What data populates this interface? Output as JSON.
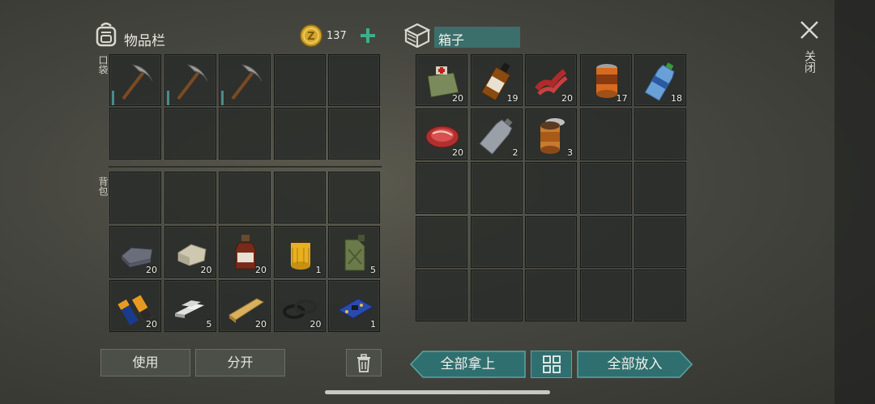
{
  "inventory": {
    "title": "物品栏",
    "coins": "137",
    "pocket_label": "口袋",
    "backpack_label": "背包",
    "pocket_slots": [
      {
        "item": "pickaxe",
        "qty": ""
      },
      {
        "item": "pickaxe",
        "qty": ""
      },
      {
        "item": "pickaxe",
        "qty": ""
      },
      {
        "item": "",
        "qty": ""
      },
      {
        "item": "",
        "qty": ""
      },
      {
        "item": "",
        "qty": ""
      },
      {
        "item": "",
        "qty": ""
      },
      {
        "item": "",
        "qty": ""
      },
      {
        "item": "",
        "qty": ""
      },
      {
        "item": "",
        "qty": ""
      }
    ],
    "backpack_slots": [
      {
        "item": "",
        "qty": ""
      },
      {
        "item": "",
        "qty": ""
      },
      {
        "item": "",
        "qty": ""
      },
      {
        "item": "",
        "qty": ""
      },
      {
        "item": "",
        "qty": ""
      },
      {
        "item": "iron-ingot",
        "qty": "20"
      },
      {
        "item": "stone-block",
        "qty": "20"
      },
      {
        "item": "brown-bottle",
        "qty": "20"
      },
      {
        "item": "oil-filter",
        "qty": "1"
      },
      {
        "item": "jerrycan",
        "qty": "5"
      },
      {
        "item": "batteries",
        "qty": "20"
      },
      {
        "item": "aluminum-bars",
        "qty": "5"
      },
      {
        "item": "wood-plank",
        "qty": "20"
      },
      {
        "item": "rubber-rings",
        "qty": "20"
      },
      {
        "item": "circuit-board",
        "qty": "1"
      }
    ],
    "use_button": "使用",
    "split_button": "分开"
  },
  "box": {
    "title": "箱子",
    "slots": [
      {
        "item": "medkit-bag",
        "qty": "20"
      },
      {
        "item": "whiskey-bottle",
        "qty": "19"
      },
      {
        "item": "bacon",
        "qty": "20"
      },
      {
        "item": "canned-food",
        "qty": "17"
      },
      {
        "item": "water-bottle",
        "qty": "18"
      },
      {
        "item": "raw-steak",
        "qty": "20"
      },
      {
        "item": "empty-bottle",
        "qty": "2"
      },
      {
        "item": "open-can",
        "qty": "3"
      }
    ],
    "take_all_button": "全部拿上",
    "put_all_button": "全部放入"
  },
  "close_label": "关闭",
  "colors": {
    "accent_teal": "#2f6f6f",
    "coin_gold": "#d4a62a",
    "plus_green": "#3fae8e"
  }
}
